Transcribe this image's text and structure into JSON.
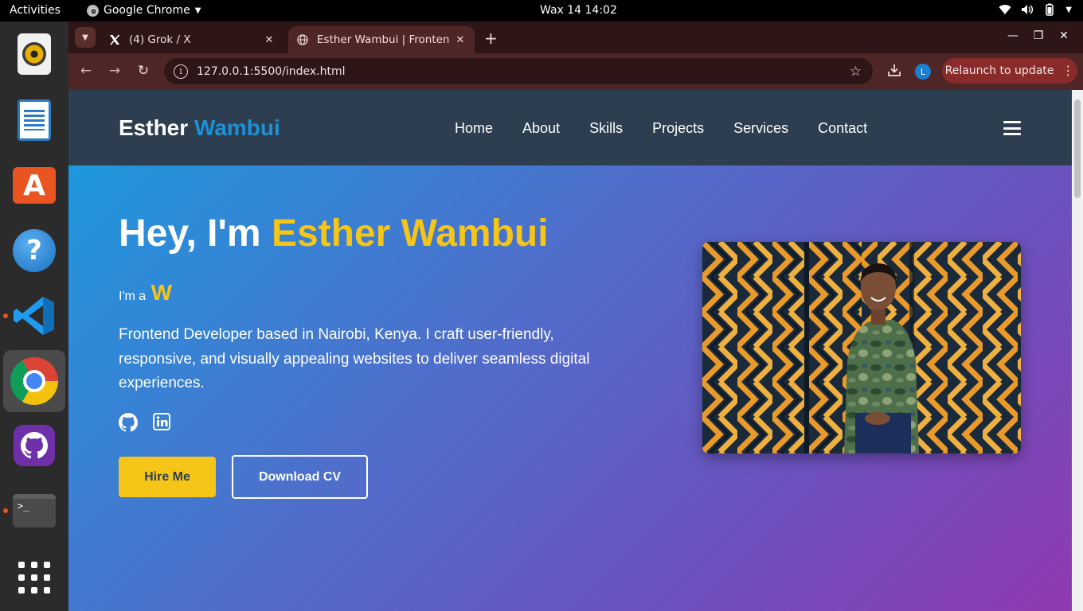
{
  "topbar": {
    "activities": "Activities",
    "app_name": "Google Chrome",
    "clock": "Wax 14  14:02"
  },
  "dock": {
    "items": [
      "rhythmbox-icon",
      "libreoffice-writer-icon",
      "app-center-icon",
      "help-icon",
      "vscode-icon",
      "chrome-icon",
      "github-desktop-icon",
      "terminal-icon",
      "show-apps-icon"
    ]
  },
  "browser": {
    "tabs": [
      {
        "title": "(4) Grok / X",
        "active": false
      },
      {
        "title": "Esther Wambui | Fronten",
        "active": true
      }
    ],
    "url": "127.0.0.1:5500/index.html",
    "avatar_letter": "L",
    "relaunch_label": "Relaunch to update"
  },
  "site": {
    "brand_first": "Esther",
    "brand_last": "Wambui",
    "nav": [
      "Home",
      "About",
      "Skills",
      "Projects",
      "Services",
      "Contact"
    ],
    "hero": {
      "greeting": "Hey, I'm",
      "name": "Esther Wambui",
      "sub_prefix": "I'm a",
      "typed_text": "W",
      "description": "Frontend Developer based in Nairobi, Kenya. I craft user-friendly, responsive, and visually appealing websites to deliver seamless digital experiences.",
      "hire_label": "Hire Me",
      "cv_label": "Download CV"
    },
    "colors": {
      "nav_bg": "#2c3e50",
      "accent_blue": "#1e90d6",
      "accent_yellow": "#f5c518"
    }
  }
}
